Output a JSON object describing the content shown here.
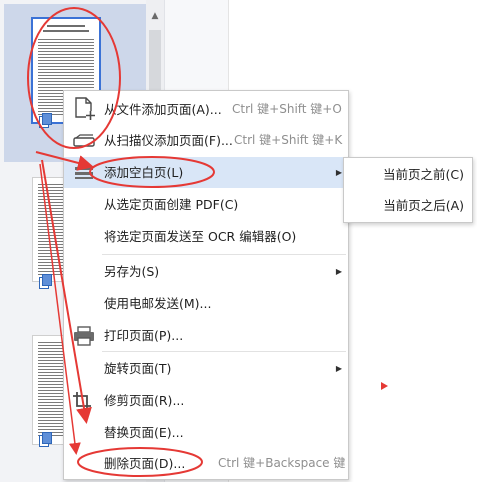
{
  "menu": {
    "items": [
      {
        "label": "从文件添加页面(A)...",
        "mnemonic": "A",
        "shortcut": "Ctrl 键+Shift 键+O",
        "icon": "add-page-icon"
      },
      {
        "label": "从扫描仪添加页面(F)...",
        "mnemonic": "F",
        "shortcut": "Ctrl 键+Shift 键+K",
        "icon": "scanner-icon"
      },
      {
        "label": "添加空白页(L)",
        "mnemonic": "L",
        "submenu": true
      },
      {
        "label": "从选定页面创建 PDF(C)",
        "mnemonic": "C"
      },
      {
        "label": "将选定页面发送至 OCR 编辑器(O)",
        "mnemonic": "O"
      },
      {
        "label": "另存为(S)",
        "mnemonic": "S",
        "submenu": true
      },
      {
        "label": "使用电邮发送(M)...",
        "mnemonic": "M"
      },
      {
        "label": "打印页面(P)...",
        "mnemonic": "P",
        "icon": "printer-icon"
      },
      {
        "label": "旋转页面(T)",
        "mnemonic": "T",
        "submenu": true
      },
      {
        "label": "修剪页面(R)...",
        "mnemonic": "R",
        "icon": "crop-icon"
      },
      {
        "label": "替换页面(E)...",
        "mnemonic": "E"
      },
      {
        "label": "删除页面(D)...",
        "mnemonic": "D",
        "shortcut": "Ctrl 键+Backspace 键"
      }
    ]
  },
  "submenu": {
    "items": [
      {
        "label": "当前页之前(C)",
        "mnemonic": "C"
      },
      {
        "label": "当前页之后(A)",
        "mnemonic": "A"
      }
    ]
  },
  "icons": {
    "submenu_arrow": "submenu-arrow-icon",
    "scroll_up": "scroll-up-arrow-icon",
    "thumbnail_badge": "page-stack-icon"
  },
  "colors": {
    "menu_highlight": "#d9e6f7",
    "selection_border": "#3b72d6",
    "annotation_red": "#e53935",
    "shortcut_text": "#8f8f8f"
  }
}
